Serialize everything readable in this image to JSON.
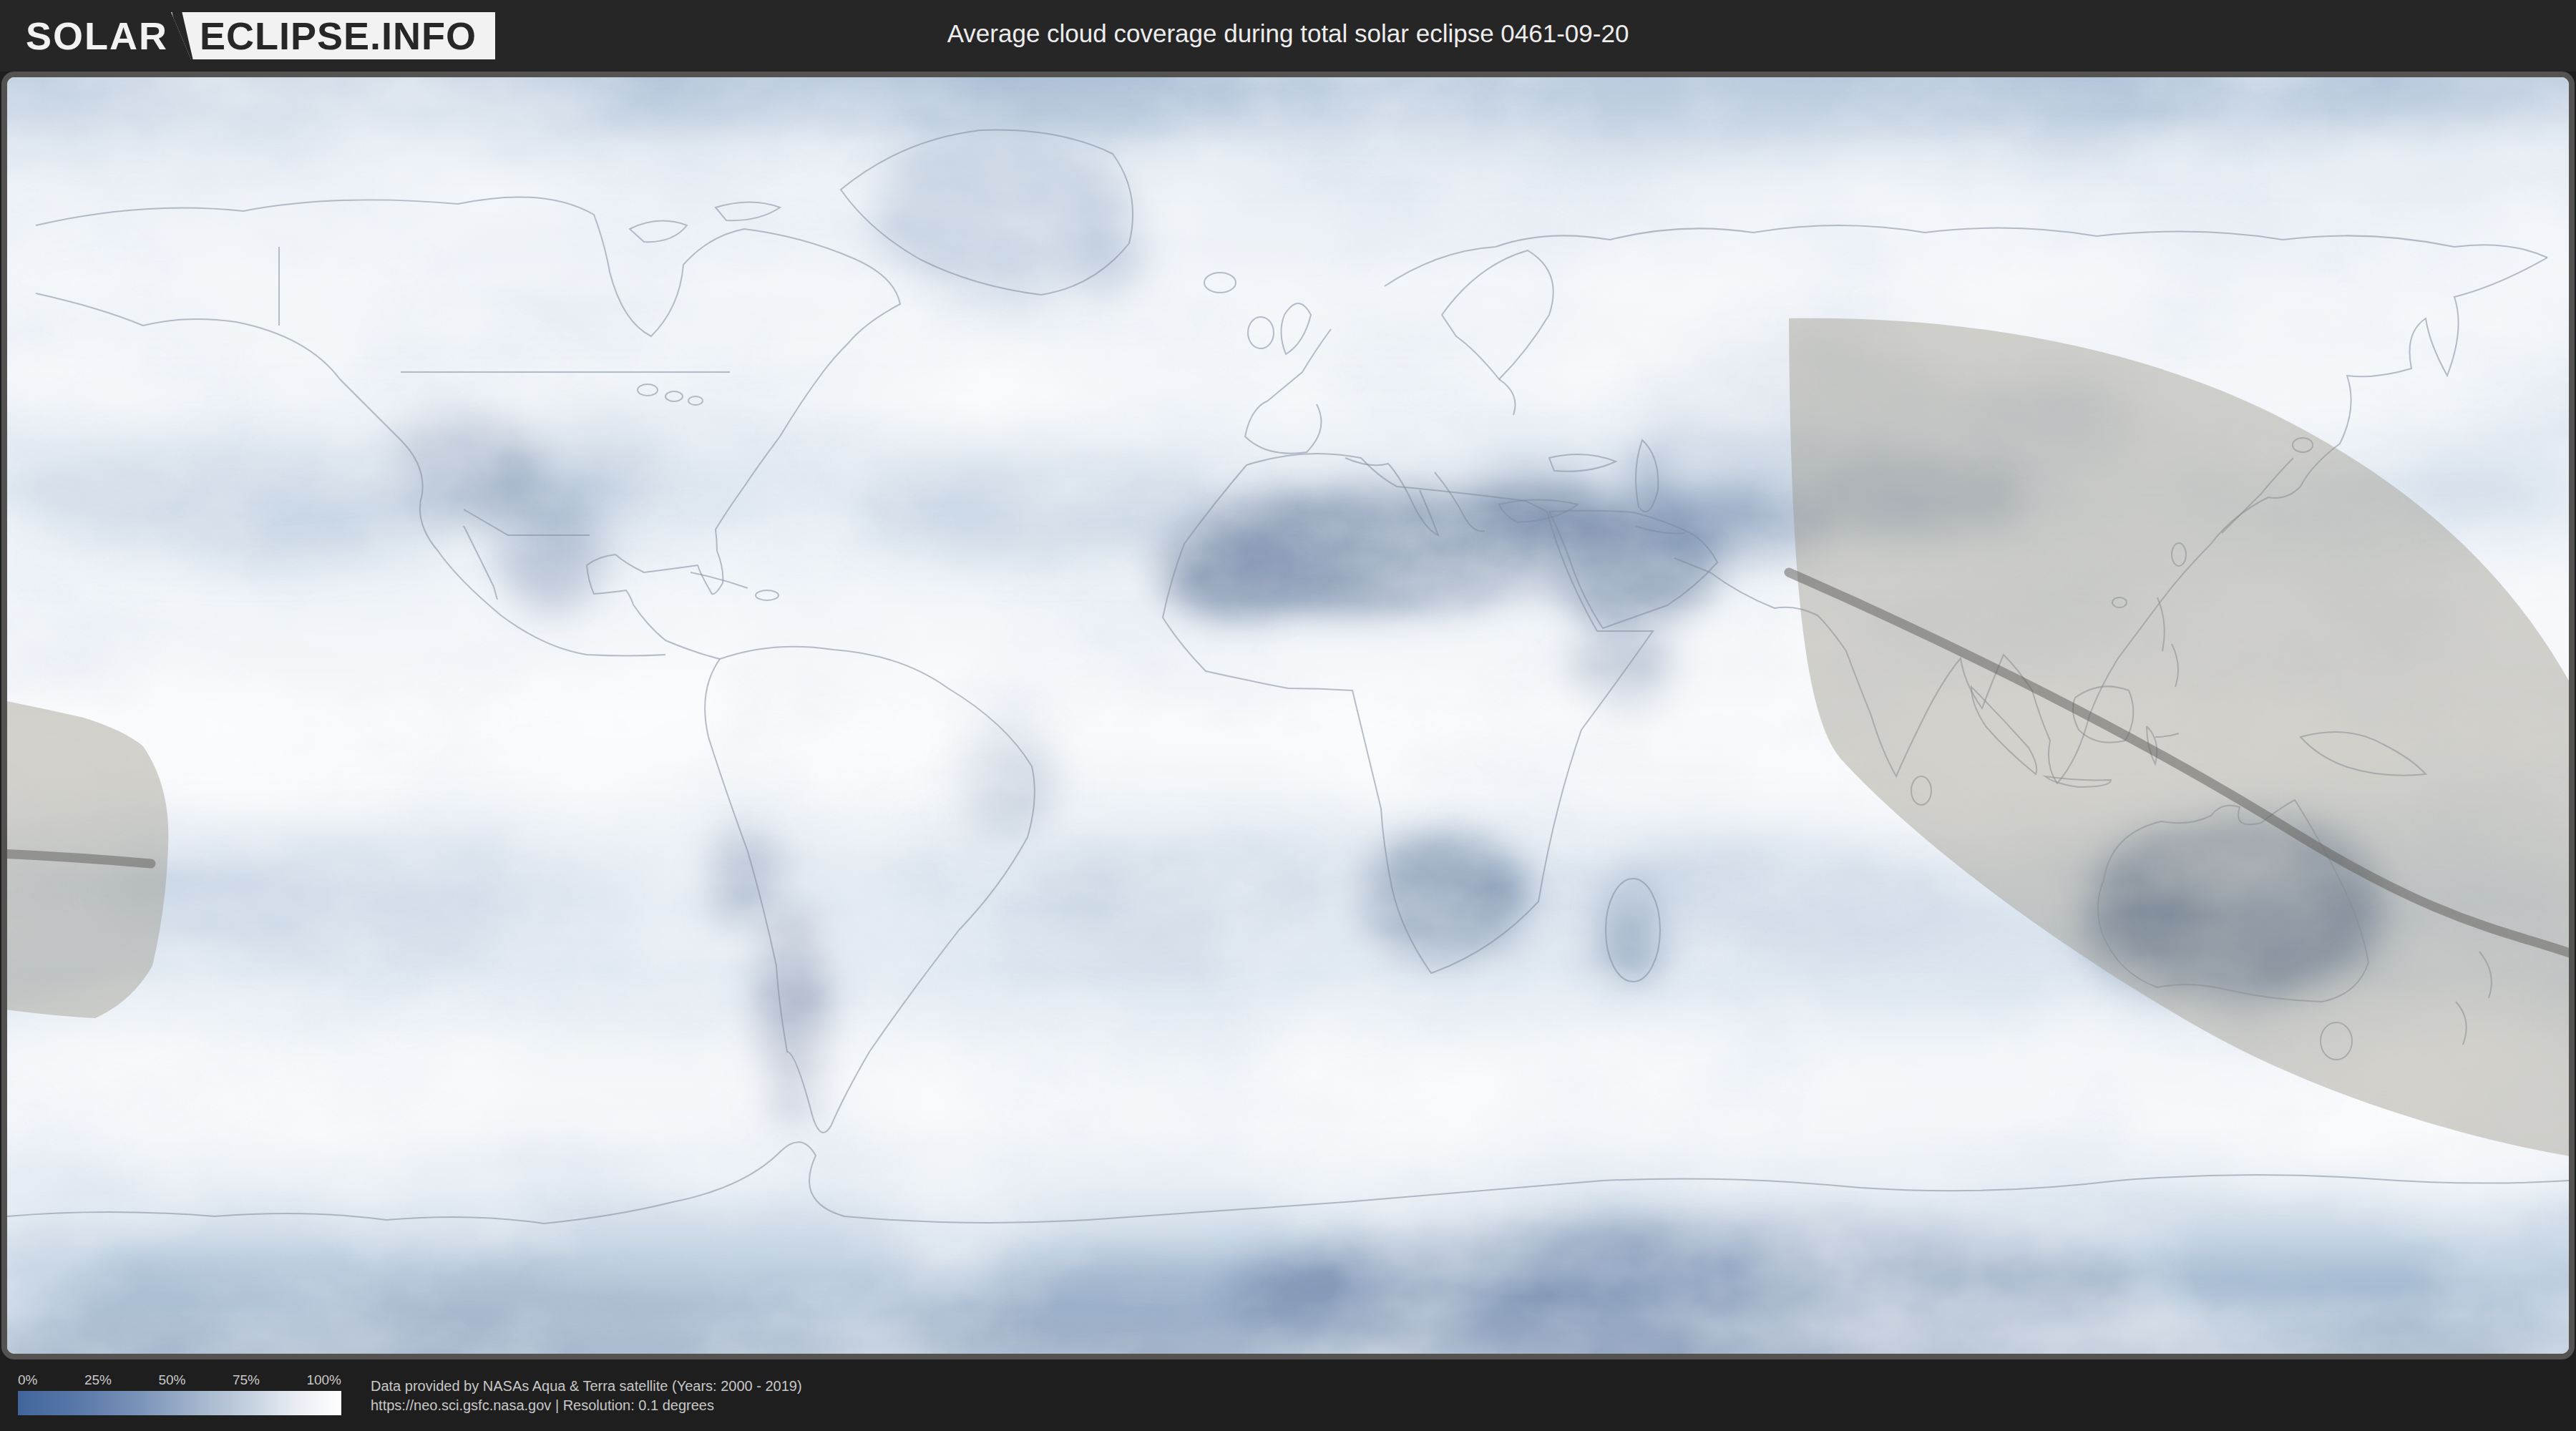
{
  "header": {
    "logo_prefix": "SOLAR",
    "logo_suffix": "ECLIPSE.INFO",
    "title": "Average cloud coverage during total solar eclipse 0461-09-20"
  },
  "map": {
    "kind": "world cloud coverage heatmap with eclipse shadow overlay",
    "overlay_color": "#969083",
    "low_cloud_color": "#5d7699",
    "high_cloud_color": "#ffffff"
  },
  "legend": {
    "ticks": [
      "0%",
      "25%",
      "50%",
      "75%",
      "100%"
    ],
    "min_color": "#41659c",
    "max_color": "#ffffff"
  },
  "footer": {
    "credit_line1": "Data provided by NASAs Aqua & Terra satellite (Years: 2000 - 2019)",
    "credit_line2": "https://neo.sci.gsfc.nasa.gov | Resolution: 0.1 degrees"
  },
  "chart_data": {
    "type": "heatmap",
    "title": "Average cloud coverage during total solar eclipse 0461-09-20",
    "value_unit": "%",
    "value_domain": [
      0,
      100
    ],
    "legend_ticks": [
      "0%",
      "25%",
      "50%",
      "75%",
      "100%"
    ],
    "colormap": [
      "#41659c",
      "#7b94b9",
      "#c6d2e0",
      "#ffffff"
    ],
    "legend_position": "bottom-left",
    "annotations": [
      "eclipse penumbra band over Asia and Australia",
      "eclipse penumbra band at far west edge",
      "eclipse central path line"
    ]
  }
}
